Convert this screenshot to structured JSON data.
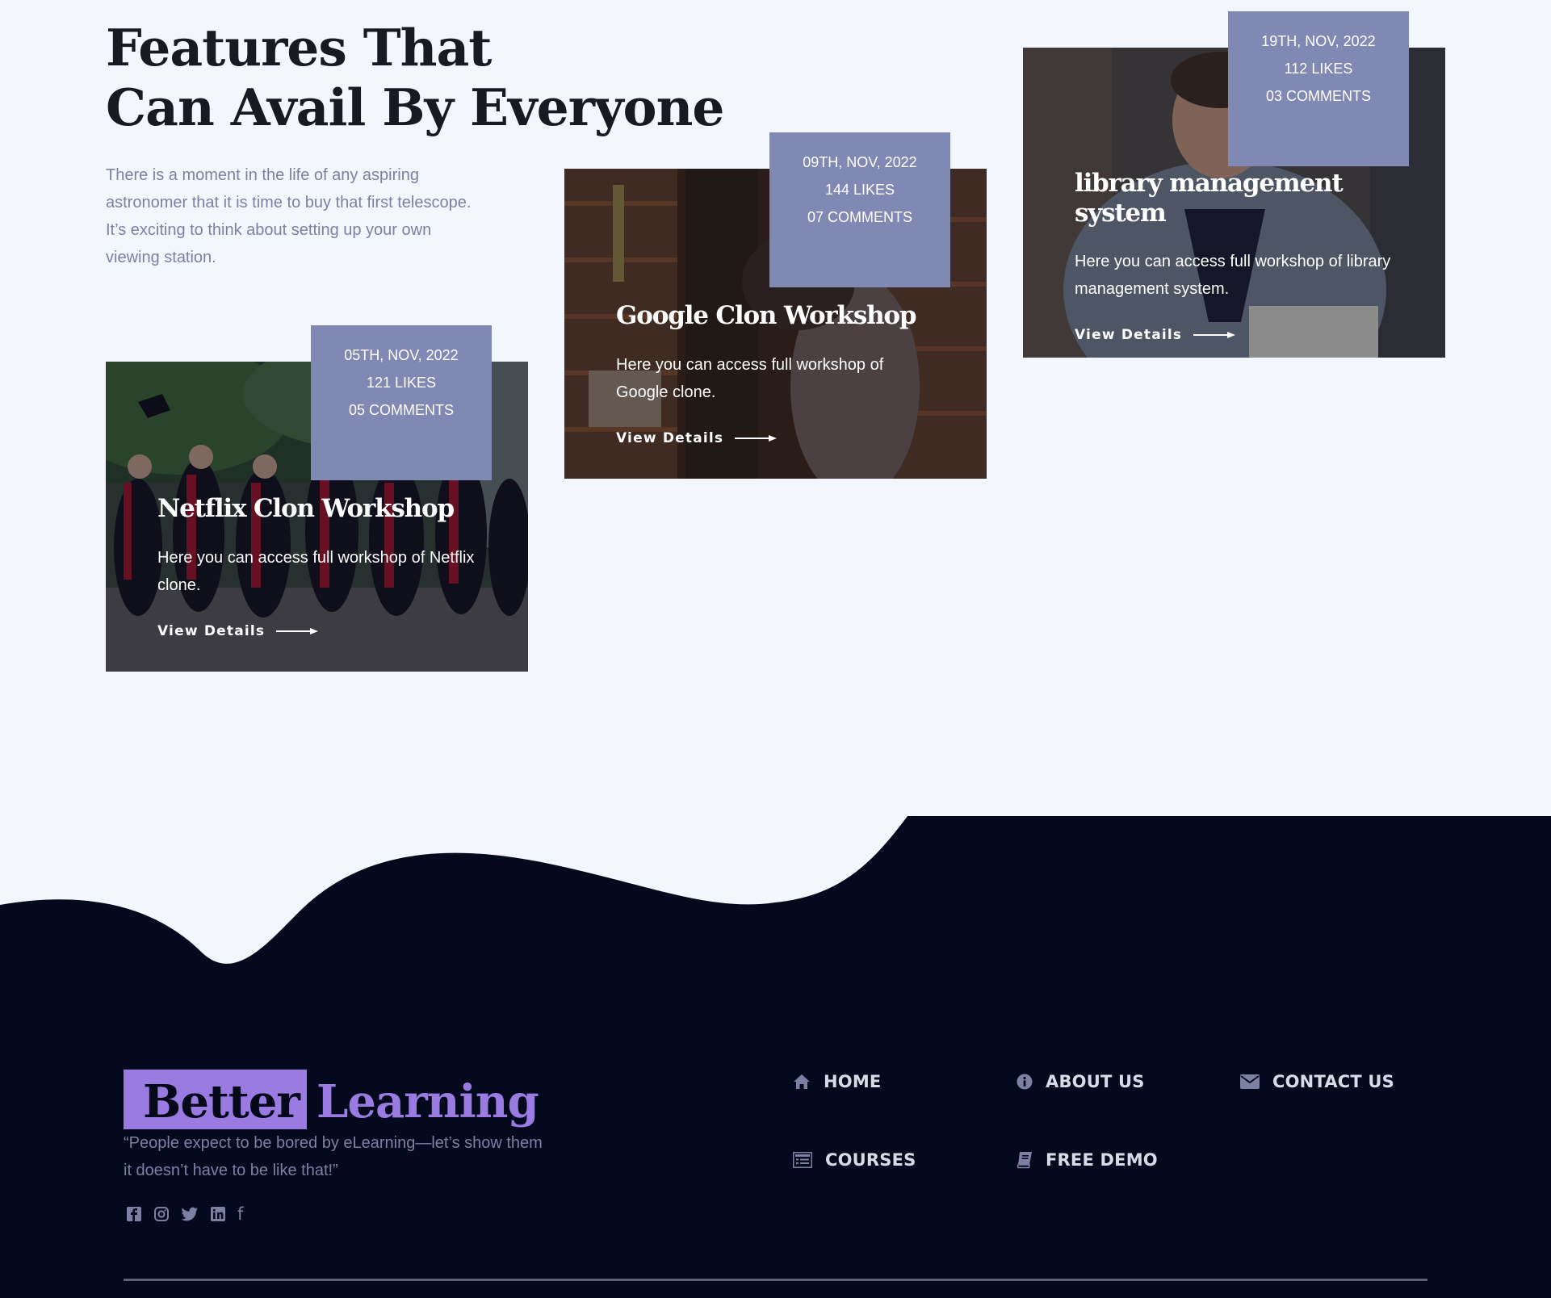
{
  "features": {
    "heading_line1": "Features That",
    "heading_line2": "Can Avail By Everyone",
    "intro": "There is a moment in the life of any aspiring astronomer that it is time to buy that first telescope. It’s exciting to think about setting up your own viewing station."
  },
  "cards": [
    {
      "date": "05TH, NOV, 2022",
      "likes": "121 LIKES",
      "comments": "05 COMMENTS",
      "title": "Netflix Clon Workshop",
      "description": "Here you can access full workshop of Netflix clone.",
      "link": "View Details",
      "image_subject": "graduates-jumping"
    },
    {
      "date": "09TH, NOV, 2022",
      "likes": "144 LIKES",
      "comments": "07 COMMENTS",
      "title": "Google Clon Workshop",
      "description": "Here you can access full workshop of Google clone.",
      "link": "View Details",
      "image_subject": "woman-in-library"
    },
    {
      "date": "19TH, NOV, 2022",
      "likes": "112 LIKES",
      "comments": "03 COMMENTS",
      "title": "library management system",
      "description": "Here you can access full workshop of library management system.",
      "link": "View Details",
      "image_subject": "student-reading"
    }
  ],
  "footer": {
    "brand_part1": "Better",
    "brand_part2": "Learning",
    "tagline": "“People expect to be bored by eLearning—let’s show them it doesn’t have to be like that!”",
    "social": [
      "facebook-square-icon",
      "instagram-icon",
      "twitter-icon",
      "linkedin-icon",
      "facebook-icon"
    ],
    "social_glyph_f": "f",
    "nav": [
      {
        "label": "HOME",
        "icon": "home-icon"
      },
      {
        "label": "ABOUT US",
        "icon": "info-icon"
      },
      {
        "label": "CONTACT US",
        "icon": "envelope-icon"
      },
      {
        "label": "COURSES",
        "icon": "list-icon"
      },
      {
        "label": "FREE DEMO",
        "icon": "book-icon"
      }
    ]
  },
  "colors": {
    "page_bg": "#f3f6fd",
    "footer_bg": "#05091e",
    "accent": "#9a7be2",
    "meta_box": "#8089b3",
    "muted_text": "#7b81a3"
  }
}
